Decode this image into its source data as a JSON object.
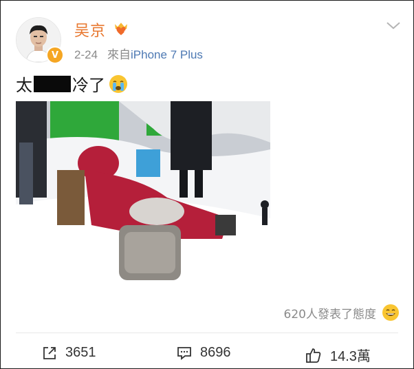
{
  "author": {
    "name": "吴京",
    "verified_badge": "V",
    "vip_icon": "crown-heart-icon"
  },
  "meta": {
    "date": "2-24",
    "source_prefix": "來自",
    "source": "iPhone 7 Plus"
  },
  "post": {
    "text_before": "太",
    "text_after": "冷了",
    "emoji": "crying-face-icon"
  },
  "reaction": {
    "text": "620人發表了態度",
    "emoji": "grin-face-icon"
  },
  "actions": {
    "repost_count": "3651",
    "comment_count": "8696",
    "like_count": "14.3萬"
  },
  "colors": {
    "username": "#e8772e",
    "link": "#4d79b3",
    "meta": "#8a8a8a",
    "badge": "#f5a623"
  }
}
